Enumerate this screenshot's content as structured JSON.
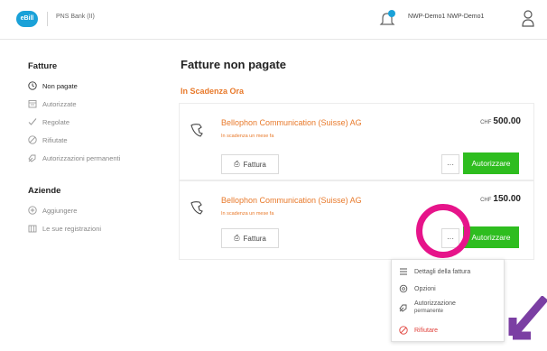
{
  "header": {
    "logo_text": "eBill",
    "bank_name": "PNS Bank (II)",
    "user_name": "NWP-Demo1 NWP-Demo1"
  },
  "sidebar": {
    "fatture_title": "Fatture",
    "fatture_items": [
      {
        "label": "Non pagate",
        "icon": "clock-icon",
        "active": true
      },
      {
        "label": "Autorizzate",
        "icon": "calendar-icon",
        "active": false
      },
      {
        "label": "Regolate",
        "icon": "check-icon",
        "active": false
      },
      {
        "label": "Rifiutate",
        "icon": "forbidden-icon",
        "active": false
      },
      {
        "label": "Autorizzazioni permanenti",
        "icon": "tag-icon",
        "active": false
      }
    ],
    "aziende_title": "Aziende",
    "aziende_items": [
      {
        "label": "Aggiungere",
        "icon": "plus-circle-icon"
      },
      {
        "label": "Le sue registrazioni",
        "icon": "building-icon"
      }
    ]
  },
  "main": {
    "title": "Fatture non pagate",
    "section_label": "In Scadenza Ora",
    "invoices": [
      {
        "company": "Bellophon Communication (Suisse) AG",
        "due": "In scadenza un mese fa",
        "currency": "CHF",
        "amount": "500.00",
        "fattura_label": "Fattura",
        "more_label": "···",
        "authorize_label": "Autorizzare"
      },
      {
        "company": "Bellophon Communication (Suisse) AG",
        "due": "In scadenza un mese fa",
        "currency": "CHF",
        "amount": "150.00",
        "fattura_label": "Fattura",
        "more_label": "···",
        "authorize_label": "Autorizzare"
      }
    ]
  },
  "context_menu": {
    "items": [
      {
        "label": "Dettagli della fattura",
        "icon": "list-icon"
      },
      {
        "label": "Opzioni",
        "icon": "gear-icon"
      },
      {
        "label": "Autorizzazione",
        "sub": "permanente",
        "icon": "tag-icon"
      },
      {
        "label": "Rifiutare",
        "icon": "forbidden-icon",
        "danger": true
      }
    ]
  },
  "colors": {
    "accent_orange": "#e8792a",
    "authorize_green": "#2ebd1f",
    "highlight_magenta": "#e6148a",
    "arrow_purple": "#7b3fa3",
    "logo_blue": "#1aa1d8",
    "danger_red": "#e0413b"
  }
}
